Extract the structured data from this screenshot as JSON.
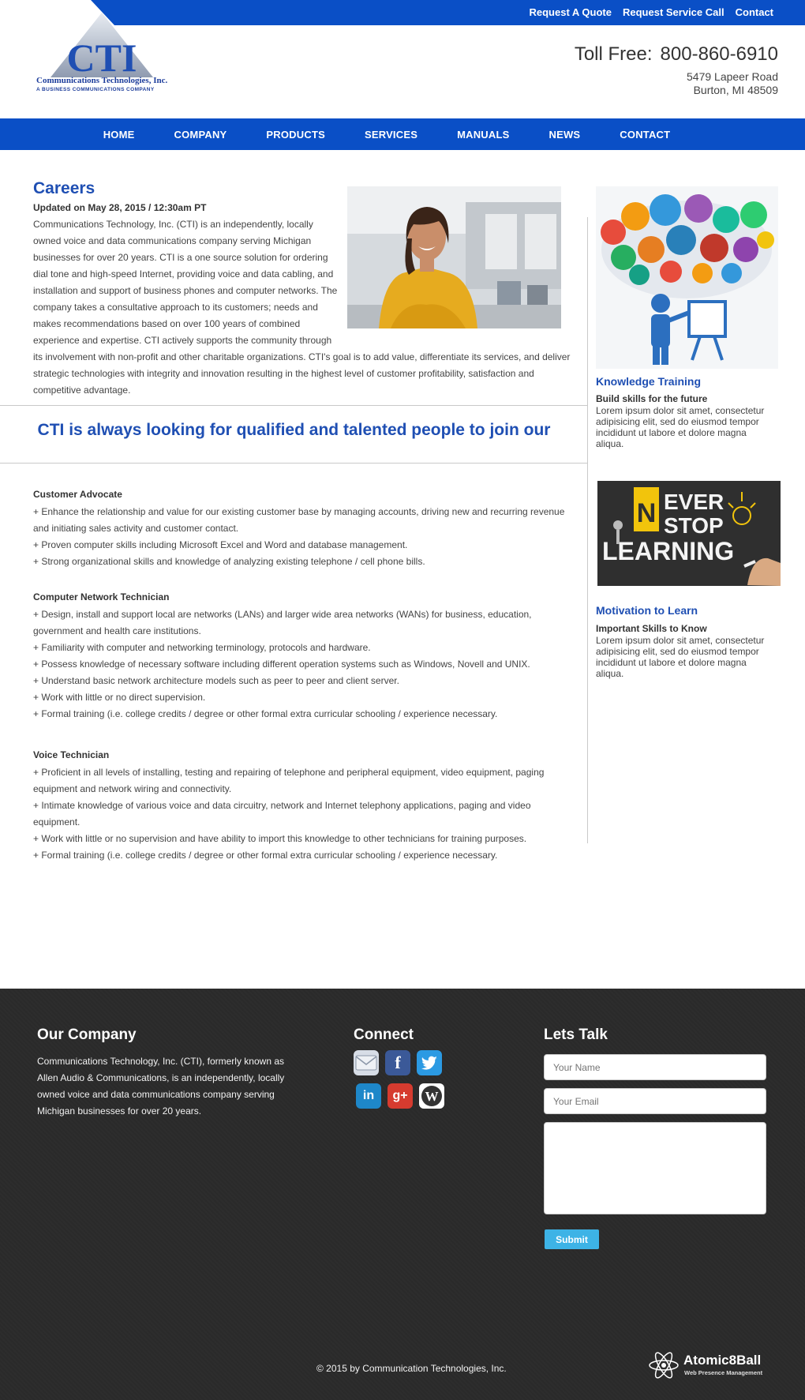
{
  "toplinks": [
    "Request A Quote",
    "Request Service Call",
    "Contact"
  ],
  "logo": {
    "letters": "CTI",
    "name": "Communications Technologies, Inc.",
    "tagline": "A BUSINESS COMMUNICATIONS COMPANY"
  },
  "header": {
    "tollfree_label": "Toll Free:",
    "phone": "800-860-6910",
    "address_line1": "5479 Lapeer Road",
    "address_line2": "Burton, MI 48509"
  },
  "nav": [
    "HOME",
    "COMPANY",
    "PRODUCTS",
    "SERVICES",
    "MANUALS",
    "NEWS",
    "CONTACT"
  ],
  "main": {
    "title": "Careers",
    "updated": "Updated on May 28, 2015 / 12:30am PT",
    "intro": "Communications Technology, Inc. (CTI) is an independently, locally owned voice and data communications company serving Michigan businesses for over 20 years. CTI is a one source solution for ordering dial tone and high-speed Internet, providing voice and data cabling, and installation and support of business phones and computer networks. The company takes a consultative approach to its customers; needs and makes recommendations based on over 100 years of combined experience and expertise. CTI actively supports the community through its involvement with non-profit and other charitable organizations. CTI's goal is to add value, differentiate its services, and deliver strategic technologies with integrity and innovation resulting in the highest level of customer profitability, satisfaction and competitive advantage.",
    "banner": "CTI is always looking for qualified and talented people to join our",
    "jobs": [
      {
        "title": "Customer Advocate",
        "items": [
          "+ Enhance the relationship and value for our existing customer base by managing accounts, driving new and recurring revenue and initiating sales activity and customer contact.",
          "+ Proven computer skills including Microsoft Excel and Word and database management.",
          "+ Strong organizational skills and knowledge of analyzing existing telephone / cell phone bills."
        ]
      },
      {
        "title": "Computer Network Technician",
        "items": [
          "+ Design, install and support local are networks (LANs) and larger wide area networks (WANs) for business, education, government and health care institutions.",
          "+ Familiarity with computer and networking terminology, protocols and hardware.",
          "+ Possess knowledge of necessary software including different operation systems such as Windows, Novell and UNIX.",
          "+ Understand basic network architecture models such as peer to peer and client server.",
          "+ Work with little or no direct supervision.",
          "+ Formal training (i.e. college credits / degree or other formal extra curricular schooling / experience necessary."
        ]
      },
      {
        "title": "Voice Technician",
        "items": [
          "+ Proficient in all levels of installing, testing and repairing of telephone and peripheral equipment, video equipment, paging equipment and network wiring and connectivity.",
          "+ Intimate knowledge of various voice and data circuitry, network and Internet telephony applications, paging and video equipment.",
          "+ Work with little or no supervision and have ability to import this knowledge to other technicians for training purposes.",
          "+ Formal training (i.e. college credits / degree or other formal extra curricular schooling / experience necessary."
        ]
      }
    ]
  },
  "sidebar": [
    {
      "title": "Knowledge Training",
      "subtitle": "Build skills for the future",
      "text": "Lorem ipsum dolor sit amet, consectetur adipisicing elit, sed do eiusmod tempor incididunt ut labore et dolore magna aliqua."
    },
    {
      "image_words": [
        "N",
        "EVER",
        "STOP",
        "LEARNING"
      ],
      "title": "Motivation to Learn",
      "subtitle": "Important Skills to Know",
      "text": "Lorem ipsum dolor sit amet, consectetur adipisicing elit, sed do eiusmod tempor incididunt ut labore et dolore magna aliqua."
    }
  ],
  "footer": {
    "company_heading": "Our Company",
    "company_text": "Communications Technology, Inc. (CTI), formerly known as Allen Audio & Communications, is an independently, locally owned voice and data communications company serving Michigan businesses for over 20 years.",
    "connect_heading": "Connect",
    "social_icons": [
      "email-icon",
      "facebook-icon",
      "twitter-icon",
      "linkedin-icon",
      "google-plus-icon",
      "wordpress-icon"
    ],
    "social_glyphs": {
      "facebook": "f",
      "linkedin": "in",
      "googleplus": "g+",
      "wordpress": "W"
    },
    "talk_heading": "Lets Talk",
    "name_placeholder": "Your Name",
    "email_placeholder": "Your Email",
    "submit_label": "Submit",
    "copyright": "© 2015 by Communication Technologies, Inc.",
    "credit_name": "Atomic8Ball",
    "credit_tagline": "Web Presence Management"
  },
  "colors": {
    "brand_blue": "#0a4fc6",
    "heading_blue": "#1f4fb3",
    "footer_bg": "#2a2a2a",
    "submit_blue": "#3db3e6"
  }
}
